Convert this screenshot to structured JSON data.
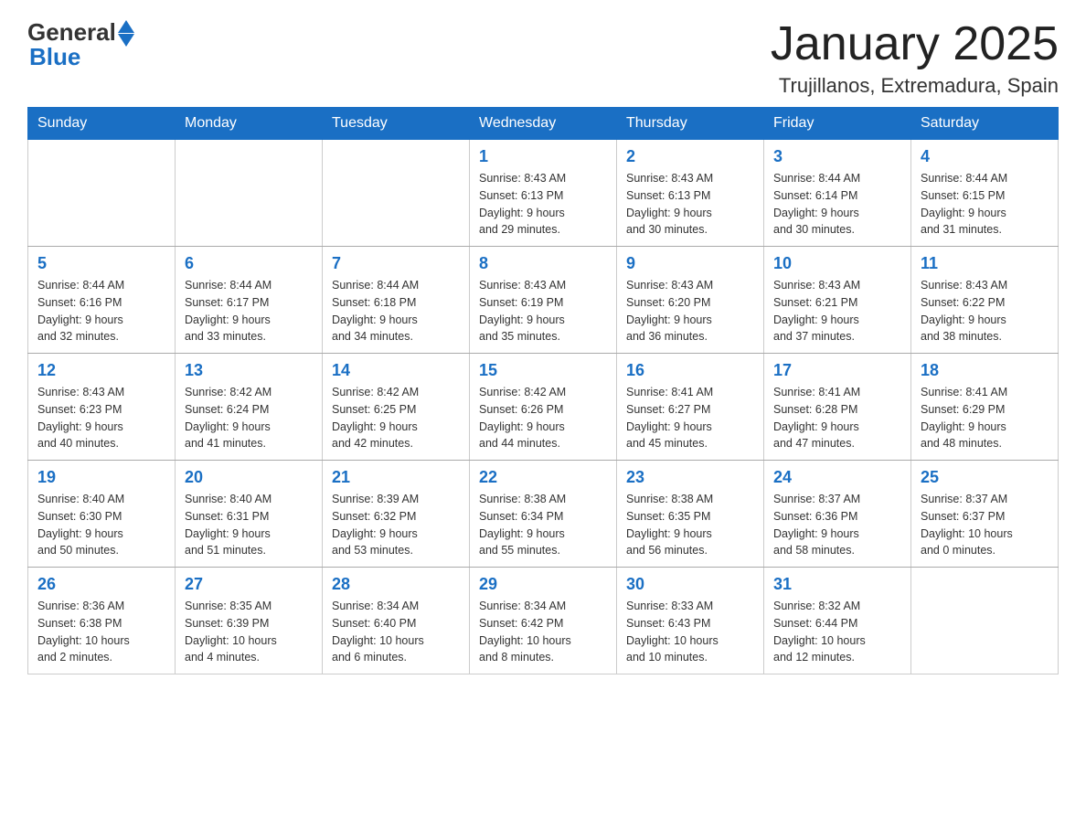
{
  "header": {
    "logo_general": "General",
    "logo_blue": "Blue",
    "month_title": "January 2025",
    "location": "Trujillanos, Extremadura, Spain"
  },
  "days_of_week": [
    "Sunday",
    "Monday",
    "Tuesday",
    "Wednesday",
    "Thursday",
    "Friday",
    "Saturday"
  ],
  "weeks": [
    [
      {
        "day": "",
        "info": ""
      },
      {
        "day": "",
        "info": ""
      },
      {
        "day": "",
        "info": ""
      },
      {
        "day": "1",
        "info": "Sunrise: 8:43 AM\nSunset: 6:13 PM\nDaylight: 9 hours\nand 29 minutes."
      },
      {
        "day": "2",
        "info": "Sunrise: 8:43 AM\nSunset: 6:13 PM\nDaylight: 9 hours\nand 30 minutes."
      },
      {
        "day": "3",
        "info": "Sunrise: 8:44 AM\nSunset: 6:14 PM\nDaylight: 9 hours\nand 30 minutes."
      },
      {
        "day": "4",
        "info": "Sunrise: 8:44 AM\nSunset: 6:15 PM\nDaylight: 9 hours\nand 31 minutes."
      }
    ],
    [
      {
        "day": "5",
        "info": "Sunrise: 8:44 AM\nSunset: 6:16 PM\nDaylight: 9 hours\nand 32 minutes."
      },
      {
        "day": "6",
        "info": "Sunrise: 8:44 AM\nSunset: 6:17 PM\nDaylight: 9 hours\nand 33 minutes."
      },
      {
        "day": "7",
        "info": "Sunrise: 8:44 AM\nSunset: 6:18 PM\nDaylight: 9 hours\nand 34 minutes."
      },
      {
        "day": "8",
        "info": "Sunrise: 8:43 AM\nSunset: 6:19 PM\nDaylight: 9 hours\nand 35 minutes."
      },
      {
        "day": "9",
        "info": "Sunrise: 8:43 AM\nSunset: 6:20 PM\nDaylight: 9 hours\nand 36 minutes."
      },
      {
        "day": "10",
        "info": "Sunrise: 8:43 AM\nSunset: 6:21 PM\nDaylight: 9 hours\nand 37 minutes."
      },
      {
        "day": "11",
        "info": "Sunrise: 8:43 AM\nSunset: 6:22 PM\nDaylight: 9 hours\nand 38 minutes."
      }
    ],
    [
      {
        "day": "12",
        "info": "Sunrise: 8:43 AM\nSunset: 6:23 PM\nDaylight: 9 hours\nand 40 minutes."
      },
      {
        "day": "13",
        "info": "Sunrise: 8:42 AM\nSunset: 6:24 PM\nDaylight: 9 hours\nand 41 minutes."
      },
      {
        "day": "14",
        "info": "Sunrise: 8:42 AM\nSunset: 6:25 PM\nDaylight: 9 hours\nand 42 minutes."
      },
      {
        "day": "15",
        "info": "Sunrise: 8:42 AM\nSunset: 6:26 PM\nDaylight: 9 hours\nand 44 minutes."
      },
      {
        "day": "16",
        "info": "Sunrise: 8:41 AM\nSunset: 6:27 PM\nDaylight: 9 hours\nand 45 minutes."
      },
      {
        "day": "17",
        "info": "Sunrise: 8:41 AM\nSunset: 6:28 PM\nDaylight: 9 hours\nand 47 minutes."
      },
      {
        "day": "18",
        "info": "Sunrise: 8:41 AM\nSunset: 6:29 PM\nDaylight: 9 hours\nand 48 minutes."
      }
    ],
    [
      {
        "day": "19",
        "info": "Sunrise: 8:40 AM\nSunset: 6:30 PM\nDaylight: 9 hours\nand 50 minutes."
      },
      {
        "day": "20",
        "info": "Sunrise: 8:40 AM\nSunset: 6:31 PM\nDaylight: 9 hours\nand 51 minutes."
      },
      {
        "day": "21",
        "info": "Sunrise: 8:39 AM\nSunset: 6:32 PM\nDaylight: 9 hours\nand 53 minutes."
      },
      {
        "day": "22",
        "info": "Sunrise: 8:38 AM\nSunset: 6:34 PM\nDaylight: 9 hours\nand 55 minutes."
      },
      {
        "day": "23",
        "info": "Sunrise: 8:38 AM\nSunset: 6:35 PM\nDaylight: 9 hours\nand 56 minutes."
      },
      {
        "day": "24",
        "info": "Sunrise: 8:37 AM\nSunset: 6:36 PM\nDaylight: 9 hours\nand 58 minutes."
      },
      {
        "day": "25",
        "info": "Sunrise: 8:37 AM\nSunset: 6:37 PM\nDaylight: 10 hours\nand 0 minutes."
      }
    ],
    [
      {
        "day": "26",
        "info": "Sunrise: 8:36 AM\nSunset: 6:38 PM\nDaylight: 10 hours\nand 2 minutes."
      },
      {
        "day": "27",
        "info": "Sunrise: 8:35 AM\nSunset: 6:39 PM\nDaylight: 10 hours\nand 4 minutes."
      },
      {
        "day": "28",
        "info": "Sunrise: 8:34 AM\nSunset: 6:40 PM\nDaylight: 10 hours\nand 6 minutes."
      },
      {
        "day": "29",
        "info": "Sunrise: 8:34 AM\nSunset: 6:42 PM\nDaylight: 10 hours\nand 8 minutes."
      },
      {
        "day": "30",
        "info": "Sunrise: 8:33 AM\nSunset: 6:43 PM\nDaylight: 10 hours\nand 10 minutes."
      },
      {
        "day": "31",
        "info": "Sunrise: 8:32 AM\nSunset: 6:44 PM\nDaylight: 10 hours\nand 12 minutes."
      },
      {
        "day": "",
        "info": ""
      }
    ]
  ]
}
